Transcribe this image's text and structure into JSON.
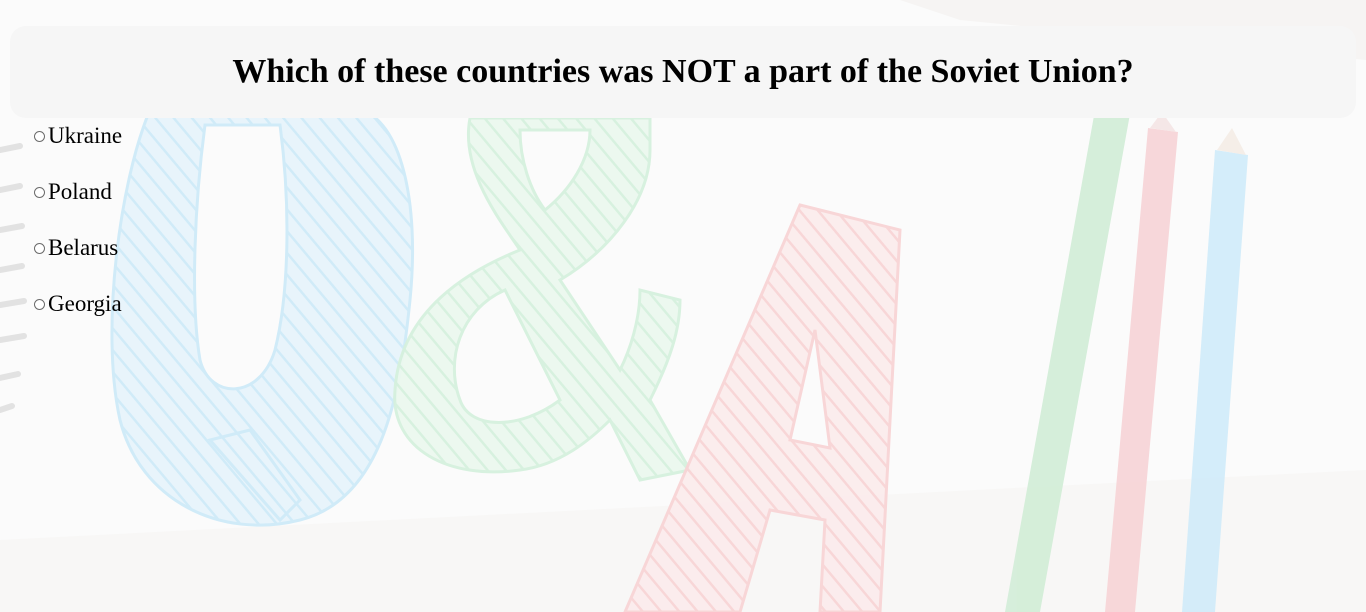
{
  "quiz": {
    "question": "Which of these countries was NOT a part of the Soviet Union?",
    "options": [
      {
        "label": "Ukraine",
        "selected": false
      },
      {
        "label": "Poland",
        "selected": false
      },
      {
        "label": "Belarus",
        "selected": false
      },
      {
        "label": "Georgia",
        "selected": false
      }
    ]
  },
  "background": {
    "image": "q-and-a-sketch-illustration",
    "colors": {
      "q": "#bfe3f6",
      "ampersand": "#c8ecd2",
      "a": "#f6c6c8",
      "pencil_green": "#bfe6c6",
      "pencil_red": "#f3c2c6",
      "pencil_blue": "#bfe3f7"
    }
  }
}
